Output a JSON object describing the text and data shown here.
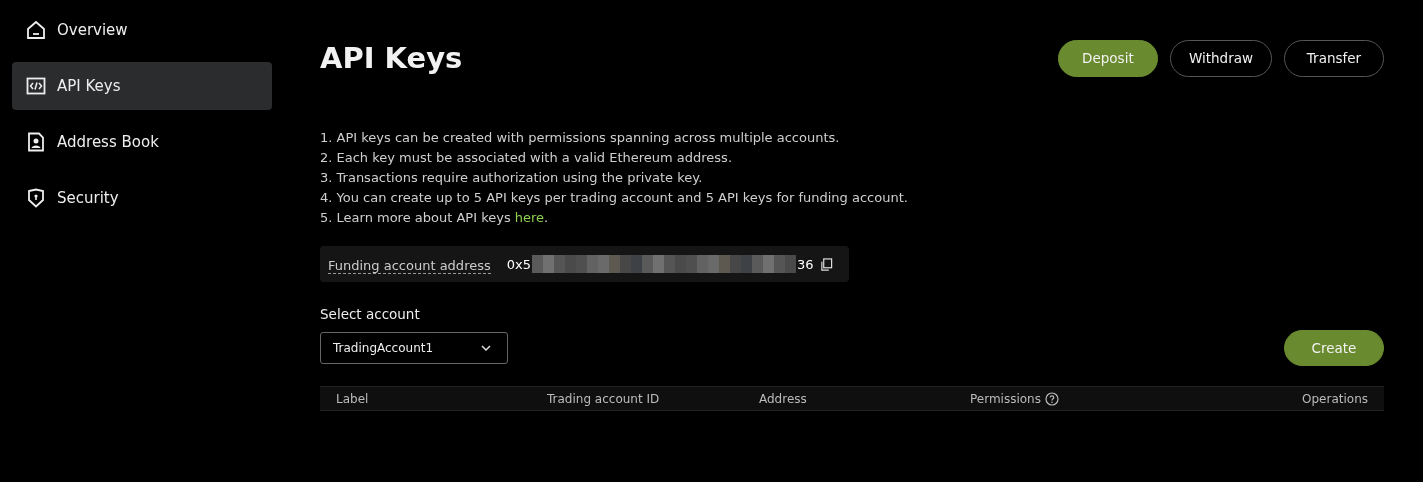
{
  "sidebar": {
    "items": [
      {
        "label": "Overview",
        "selected": false
      },
      {
        "label": "API Keys",
        "selected": true
      },
      {
        "label": "Address Book",
        "selected": false
      },
      {
        "label": "Security",
        "selected": false
      }
    ]
  },
  "page": {
    "title": "API Keys",
    "buttons": [
      {
        "label": "Deposit",
        "kind": "primary"
      },
      {
        "label": "Withdraw",
        "kind": "outline"
      },
      {
        "label": "Transfer",
        "kind": "outline"
      }
    ]
  },
  "instructions": [
    {
      "text": "1. API keys can be created with permissions spanning across multiple accounts."
    },
    {
      "text": "2. Each key must be associated with a valid Ethereum address."
    },
    {
      "text": "3. Transactions require authorization using the private key."
    },
    {
      "text": "4. You can create up to 5 API keys per trading account and 5 API keys for funding account."
    },
    {
      "text": "5. Learn more about API keys ",
      "link": "here",
      "after": "."
    }
  ],
  "funding_address": {
    "label": "Funding account address",
    "value_start": "0x5",
    "value_end": "36"
  },
  "select_account": {
    "label": "Select account",
    "value": "TradingAccount1"
  },
  "create_button": "Create",
  "table": {
    "columns": [
      {
        "label": "Label",
        "help": false
      },
      {
        "label": "Trading account ID",
        "help": false
      },
      {
        "label": "Address",
        "help": false
      },
      {
        "label": "Permissions",
        "help": true
      },
      {
        "label": "Operations",
        "help": false
      }
    ]
  }
}
